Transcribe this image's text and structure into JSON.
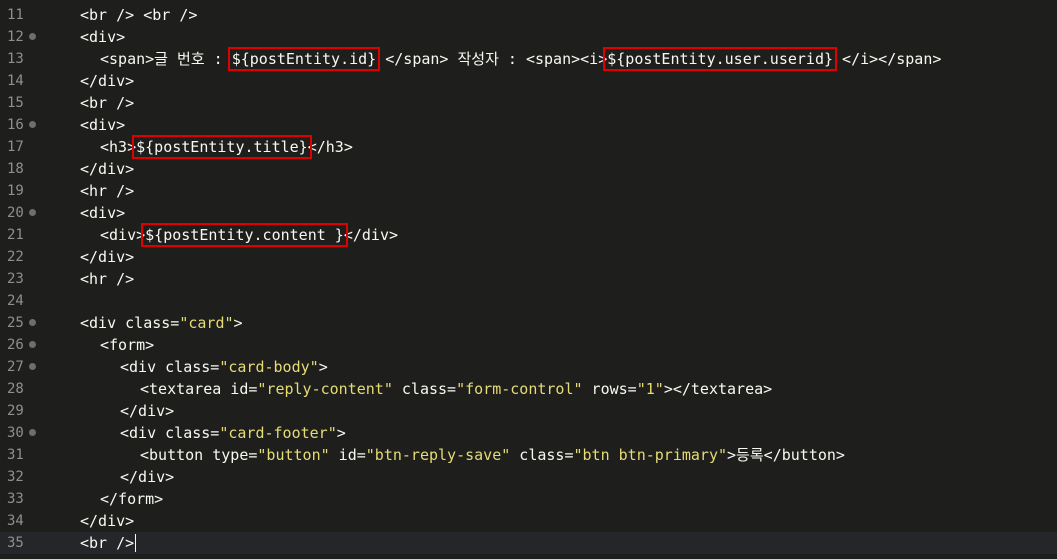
{
  "editor": {
    "lines": [
      {
        "n": "11",
        "fold": false,
        "indent": 2,
        "text": "<br /> <br />"
      },
      {
        "n": "12",
        "fold": true,
        "indent": 2,
        "text": "<div>"
      },
      {
        "n": "13",
        "fold": false,
        "indent": 3,
        "text": "<span>글 번호 : ${postEntity.id} </span> 작성자 : <span><i>${postEntity.user.userid} </i></span>"
      },
      {
        "n": "14",
        "fold": false,
        "indent": 2,
        "text": "</div>"
      },
      {
        "n": "15",
        "fold": false,
        "indent": 2,
        "text": "<br />"
      },
      {
        "n": "16",
        "fold": true,
        "indent": 2,
        "text": "<div>"
      },
      {
        "n": "17",
        "fold": false,
        "indent": 3,
        "text": "<h3>${postEntity.title}</h3>"
      },
      {
        "n": "18",
        "fold": false,
        "indent": 2,
        "text": "</div>"
      },
      {
        "n": "19",
        "fold": false,
        "indent": 2,
        "text": "<hr />"
      },
      {
        "n": "20",
        "fold": true,
        "indent": 2,
        "text": "<div>"
      },
      {
        "n": "21",
        "fold": false,
        "indent": 3,
        "text": "<div>${postEntity.content }</div>"
      },
      {
        "n": "22",
        "fold": false,
        "indent": 2,
        "text": "</div>"
      },
      {
        "n": "23",
        "fold": false,
        "indent": 2,
        "text": "<hr />"
      },
      {
        "n": "24",
        "fold": false,
        "indent": 0,
        "text": ""
      },
      {
        "n": "25",
        "fold": true,
        "indent": 2,
        "text": "<div class=\"card\">"
      },
      {
        "n": "26",
        "fold": true,
        "indent": 3,
        "text": "<form>"
      },
      {
        "n": "27",
        "fold": true,
        "indent": 4,
        "text": "<div class=\"card-body\">"
      },
      {
        "n": "28",
        "fold": false,
        "indent": 5,
        "text": "<textarea id=\"reply-content\" class=\"form-control\" rows=\"1\"></textarea>"
      },
      {
        "n": "29",
        "fold": false,
        "indent": 4,
        "text": "</div>"
      },
      {
        "n": "30",
        "fold": true,
        "indent": 4,
        "text": "<div class=\"card-footer\">"
      },
      {
        "n": "31",
        "fold": false,
        "indent": 5,
        "text": "<button type=\"button\" id=\"btn-reply-save\" class=\"btn btn-primary\">등록</button>"
      },
      {
        "n": "32",
        "fold": false,
        "indent": 4,
        "text": "</div>"
      },
      {
        "n": "33",
        "fold": false,
        "indent": 3,
        "text": "</form>"
      },
      {
        "n": "34",
        "fold": false,
        "indent": 2,
        "text": "</div>"
      },
      {
        "n": "35",
        "fold": false,
        "indent": 2,
        "text": "<br />",
        "current": true
      }
    ],
    "highlights": [
      "${postEntity.id}",
      "${postEntity.user.userid}",
      "${postEntity.title}",
      "${postEntity.content }"
    ],
    "colors": {
      "background": "#1e1f1c",
      "current_line": "#25262a",
      "text": "#f8f8f2",
      "string": "#e6db74",
      "line_number": "#8f908a",
      "highlight_box": "#e00000"
    }
  }
}
